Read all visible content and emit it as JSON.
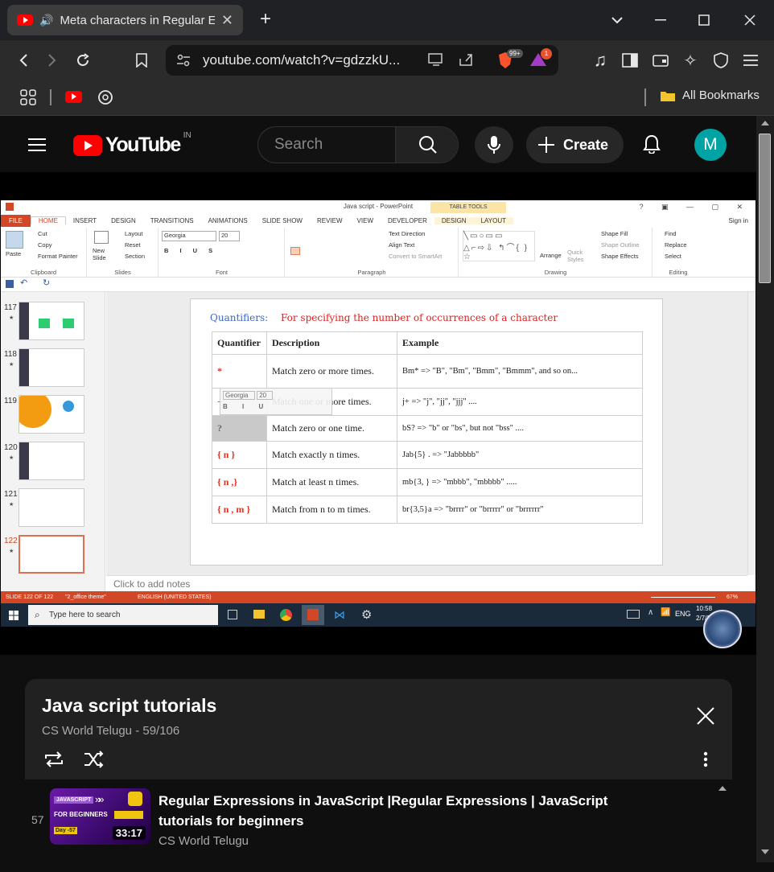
{
  "browser": {
    "tab_title": "Meta characters in Regular E",
    "url": "youtube.com/watch?v=gdzzkU...",
    "shield_badge": "99+",
    "alert_badge": "1",
    "bookmarks_label": "All Bookmarks"
  },
  "youtube": {
    "logo_text": "YouTube",
    "region": "IN",
    "search_placeholder": "Search",
    "create_label": "Create",
    "avatar_letter": "M"
  },
  "ppt": {
    "window_title": "Java script - PowerPoint",
    "table_tools": "TABLE TOOLS",
    "sign_in": "Sign in",
    "tabs": [
      "FILE",
      "HOME",
      "INSERT",
      "DESIGN",
      "TRANSITIONS",
      "ANIMATIONS",
      "SLIDE SHOW",
      "REVIEW",
      "VIEW",
      "DEVELOPER",
      "DESIGN",
      "LAYOUT"
    ],
    "ribbon": {
      "paste": "Paste",
      "cut": "Cut",
      "copy": "Copy",
      "format_painter": "Format Painter",
      "clipboard": "Clipboard",
      "new_slide": "New Slide",
      "layout": "Layout",
      "reset": "Reset",
      "section": "Section",
      "slides": "Slides",
      "font_name": "Georgia",
      "font_size": "20",
      "font": "Font",
      "text_direction": "Text Direction",
      "align_text": "Align Text",
      "convert_smartart": "Convert to SmartArt",
      "paragraph": "Paragraph",
      "arrange": "Arrange",
      "quick_styles": "Quick Styles",
      "shape_fill": "Shape Fill",
      "shape_outline": "Shape Outline",
      "shape_effects": "Shape Effects",
      "drawing": "Drawing",
      "find": "Find",
      "replace": "Replace",
      "select": "Select",
      "editing": "Editing"
    },
    "slide_numbers": [
      "117",
      "118",
      "119",
      "120",
      "121",
      "122"
    ],
    "slide": {
      "heading_label": "Quantifiers:",
      "heading_text": "For specifying the number of occurrences of a character",
      "headers": [
        "Quantifier",
        "Description",
        "Example"
      ],
      "rows": [
        {
          "q": "*",
          "d": "Match zero or more times.",
          "e": "Bm* => \"B\", \"Bm\", \"Bmm\", \"Bmmm\", and so on..."
        },
        {
          "q": "+",
          "d": "Match one or more times.",
          "e": "j+  =>  \"j\", \"jj\", \"jjj\" ...."
        },
        {
          "q": "?",
          "d": "Match zero or one time.",
          "e": "bS?  =>  \"b\" or \"bs\", but not \"bss\" ...."
        },
        {
          "q": "{ n }",
          "d": "Match exactly n times.",
          "e": "Jab{5} . => \"Jabbbbb\""
        },
        {
          "q": "{ n ,}",
          "d": "Match at least n times.",
          "e": "mb{3, } => \"mbbb\", \"mbbbb\" ....."
        },
        {
          "q": "{ n , m }",
          "d": "Match from n to m times.",
          "e": "br{3,5}a => \"brrrr\" or \"brrrrr\" or \"brrrrrr\""
        }
      ]
    },
    "notes_placeholder": "Click to add notes",
    "status": {
      "slide_info": "SLIDE 122 OF 122",
      "theme": "\"2_office theme\"",
      "language": "ENGLISH (UNITED STATES)",
      "zoom": "67%"
    },
    "taskbar": {
      "search_placeholder": "Type here to search",
      "lang": "ENG",
      "time": "10:58",
      "date": "2/7/2024"
    }
  },
  "playlist": {
    "title": "Java script tutorials",
    "channel": "CS World Telugu",
    "position": "59/106",
    "video": {
      "index": "57",
      "title": "Regular Expressions in JavaScript |Regular Expressions | JavaScript tutorials for beginners",
      "channel": "CS World Telugu",
      "duration": "33:17",
      "thumb_line1": "JAVASCRIPT",
      "thumb_line2": "FOR BEGINNERS",
      "thumb_day": "Day -57"
    }
  },
  "colors": {
    "yt_red": "#ff0000",
    "ppt_orange": "#d24726",
    "avatar": "#00a3a3",
    "quantifier_red": "#e03020",
    "heading_blue": "#3a66c4"
  }
}
